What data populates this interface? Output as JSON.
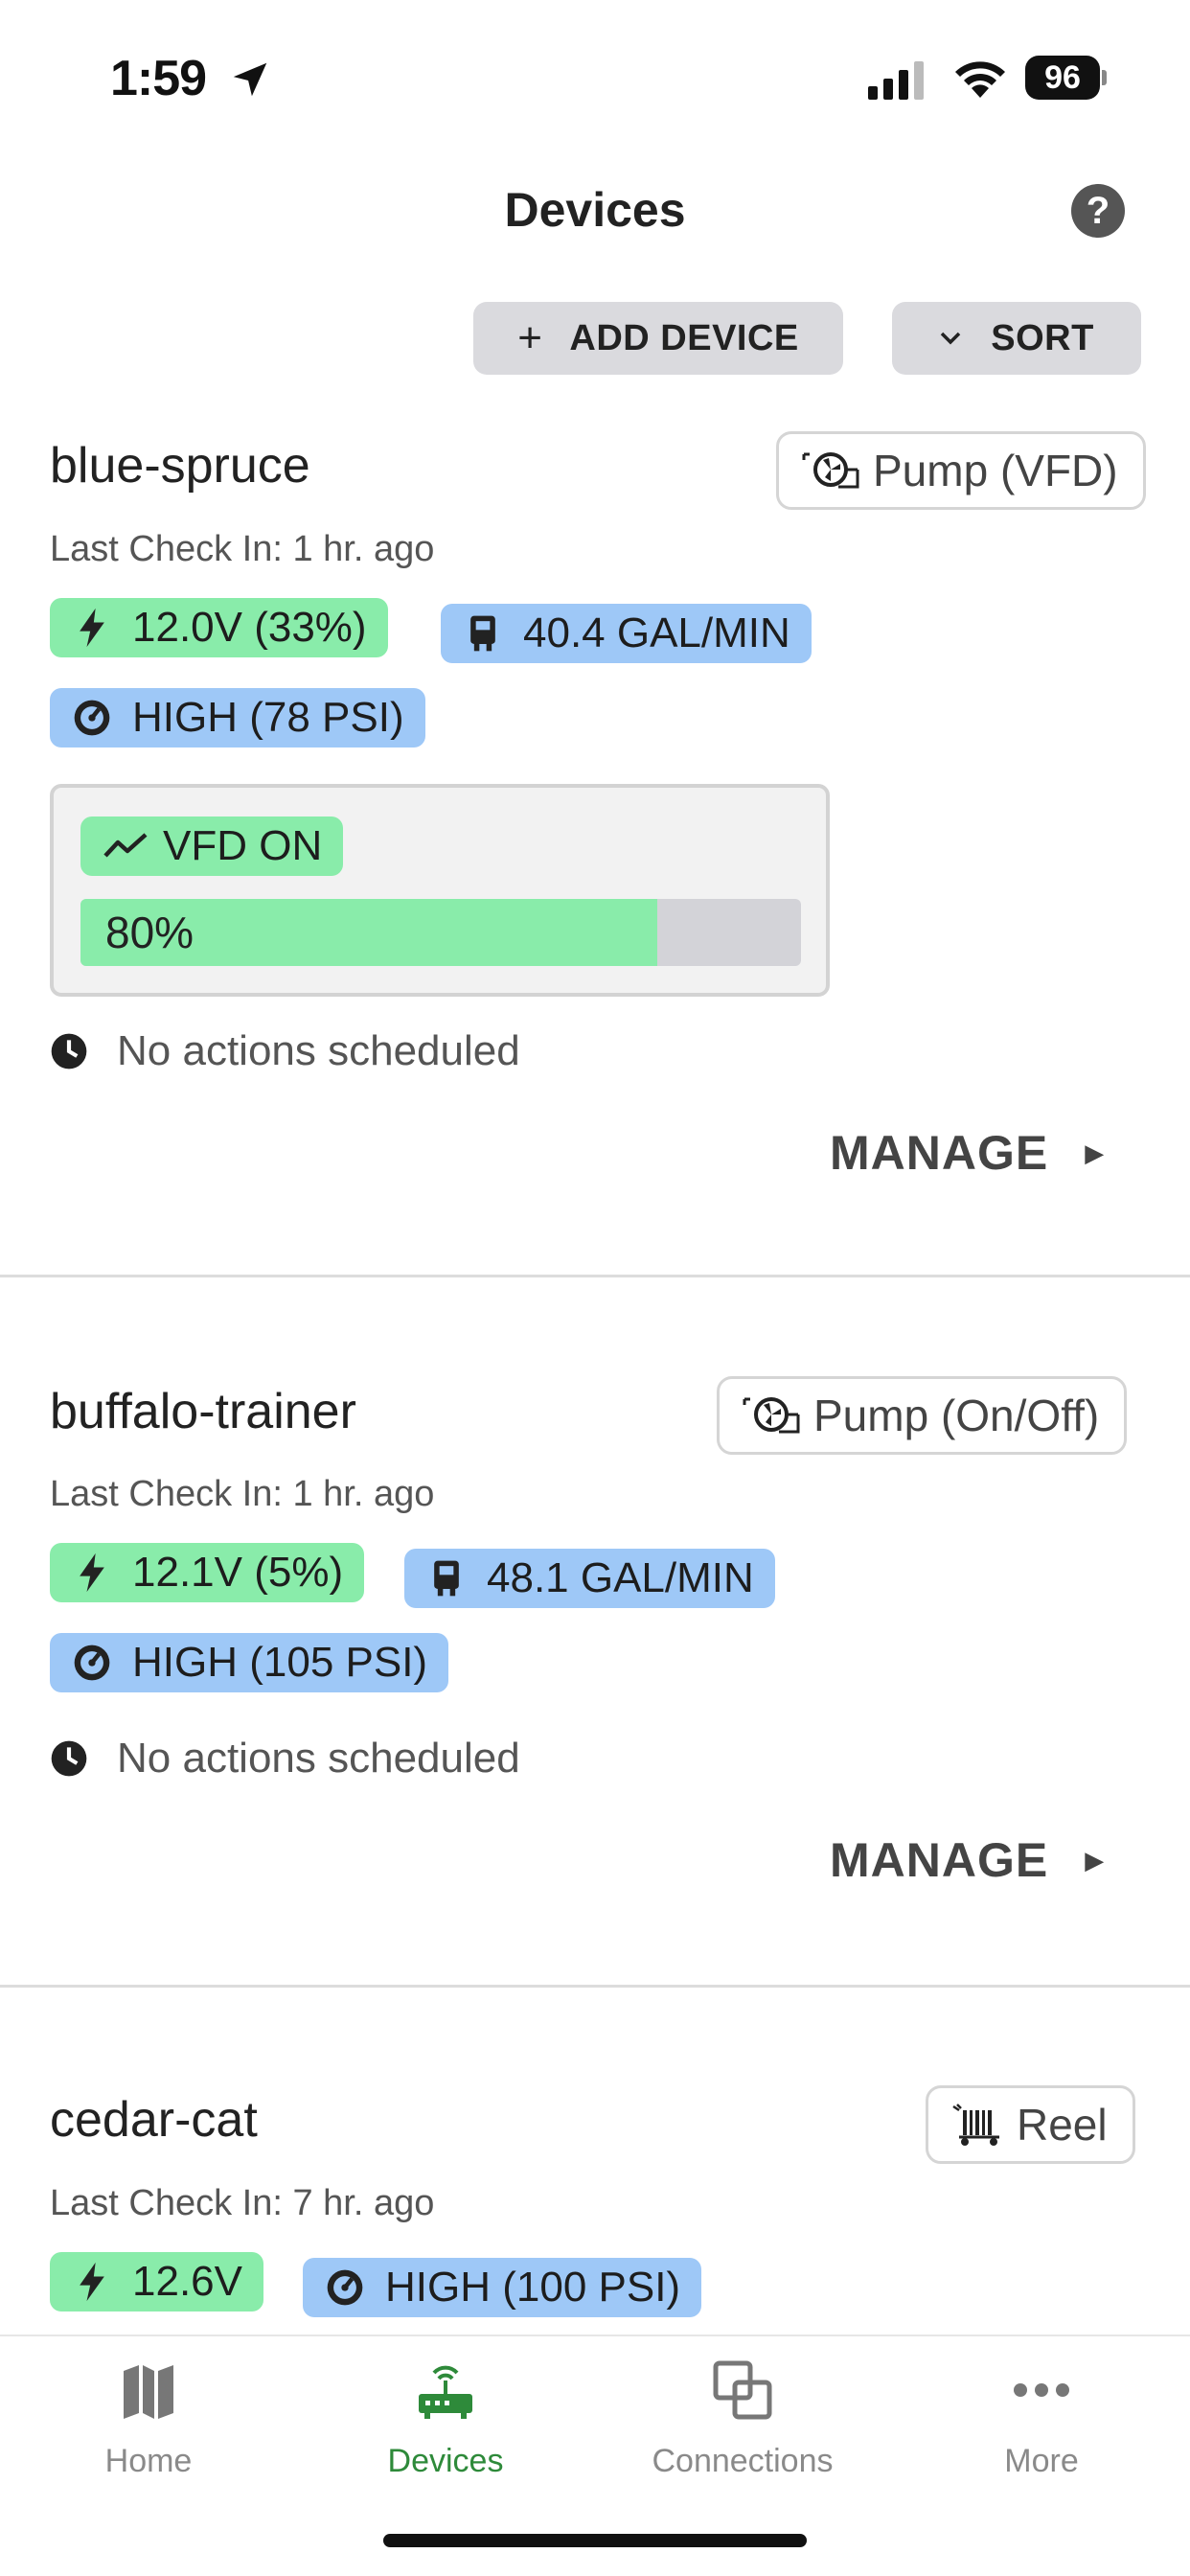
{
  "status_bar": {
    "time": "1:59",
    "battery": "96"
  },
  "header": {
    "title": "Devices",
    "help": "?"
  },
  "toolbar": {
    "add_device": "ADD DEVICE",
    "sort": "SORT"
  },
  "devices": [
    {
      "name": "blue-spruce",
      "type": "Pump (VFD)",
      "last_check_in": "Last Check In: 1 hr. ago",
      "voltage": "12.0V (33%)",
      "flow": "40.4 GAL/MIN",
      "pressure": "HIGH (78 PSI)",
      "vfd_status": "VFD ON",
      "vfd_speed_label": "80%",
      "vfd_speed": 0.8,
      "schedule": "No actions scheduled",
      "manage": "MANAGE"
    },
    {
      "name": "buffalo-trainer",
      "type": "Pump (On/Off)",
      "last_check_in": "Last Check In: 1 hr. ago",
      "voltage": "12.1V (5%)",
      "flow": "48.1 GAL/MIN",
      "pressure": "HIGH (105 PSI)",
      "schedule": "No actions scheduled",
      "manage": "MANAGE"
    },
    {
      "name": "cedar-cat",
      "type": "Reel",
      "last_check_in": "Last Check In: 7 hr. ago",
      "voltage": "12.6V",
      "pressure": "HIGH (100 PSI)"
    }
  ],
  "tabs": [
    {
      "label": "Home",
      "icon": "map-icon"
    },
    {
      "label": "Devices",
      "icon": "router-icon"
    },
    {
      "label": "Connections",
      "icon": "connections-icon"
    },
    {
      "label": "More",
      "icon": "more-icon"
    }
  ],
  "colors": {
    "green_chip": "#89ecaa",
    "blue_chip": "#9ec8f7",
    "active_tab": "#2e8a3a"
  }
}
